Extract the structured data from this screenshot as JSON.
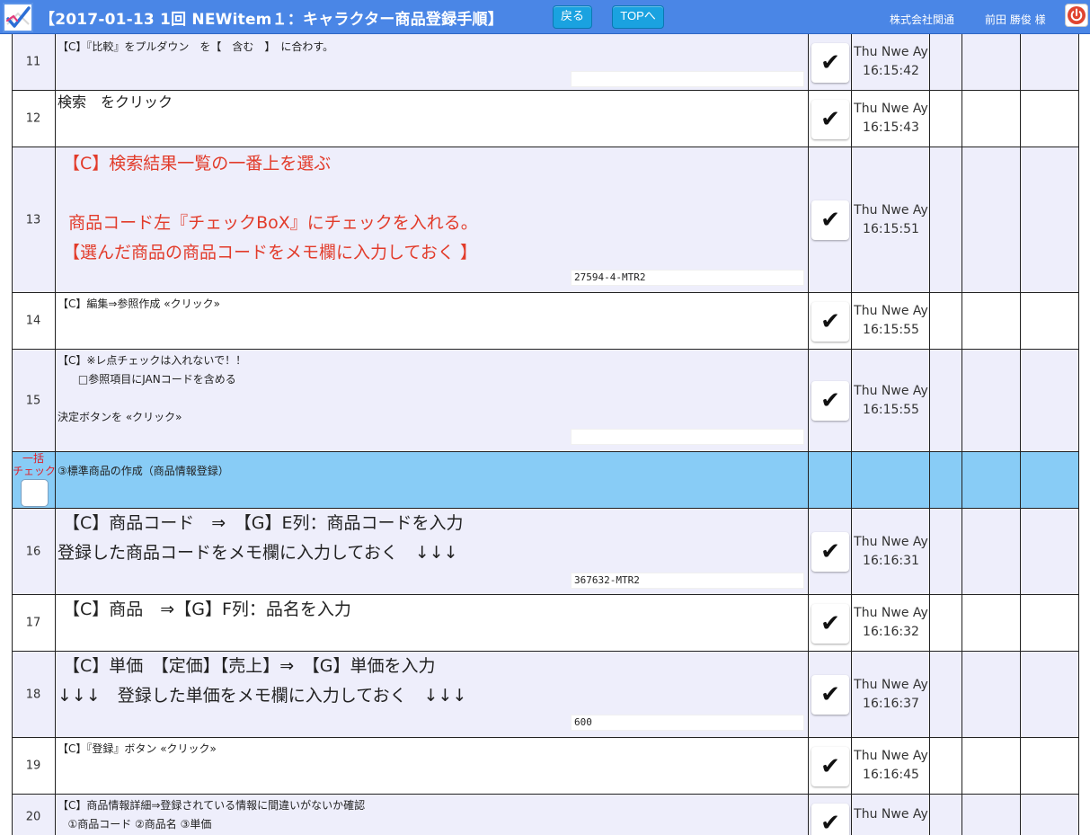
{
  "header": {
    "title": "【2017-01-13 1回 NEWitem１：キャラクター商品登録手順】",
    "back_label": "戻る",
    "top_label": "TOPへ",
    "company": "株式会社関通",
    "user": "前田 勝俊 様",
    "accent_color": "#4a86e6",
    "logo_icon": "checkmark-logo-icon",
    "power_icon": "power-icon"
  },
  "bulk_check": {
    "label_line1": "一括",
    "label_line2": "チェック"
  },
  "check_mark": "✔",
  "rows": [
    {
      "num": "11",
      "lines": [
        "【C】『比較』をプルダウン　を【　含む　】　に合わす。"
      ],
      "memo": "",
      "checked": true,
      "time_line1": "Thu Nwe Ay",
      "time_line2": "16:15:42"
    },
    {
      "num": "12",
      "lines": [
        "検索　をクリック"
      ],
      "memo": "",
      "checked": true,
      "time_line1": "Thu Nwe Ay",
      "time_line2": "16:15:43"
    },
    {
      "num": "13",
      "lines": [
        " 【C】検索結果一覧の一番上を選ぶ",
        "",
        "  商品コード左『チェックBoX』にチェックを入れる。",
        " 【選んだ商品の商品コードをメモ欄に入力しておく 】"
      ],
      "memo": "27594-4-MTR2",
      "checked": true,
      "time_line1": "Thu Nwe Ay",
      "time_line2": "16:15:51"
    },
    {
      "num": "14",
      "lines": [
        "【C】編集⇒参照作成 «クリック»"
      ],
      "memo": "",
      "checked": true,
      "time_line1": "Thu Nwe Ay",
      "time_line2": "16:15:55"
    },
    {
      "num": "15",
      "lines": [
        "【C】※レ点チェックは入れないで！！",
        "      □参照項目にJANコードを含める",
        "",
        "決定ボタンを «クリック»"
      ],
      "memo": "",
      "checked": true,
      "time_line1": "Thu Nwe Ay",
      "time_line2": "16:15:55"
    },
    {
      "num": "",
      "section": true,
      "lines": [
        "③標準商品の作成（商品情報登録）"
      ]
    },
    {
      "num": "16",
      "lines": [
        " 【C】商品コード　⇒　【G】E列：商品コードを入力",
        "登録した商品コードをメモ欄に入力しておく　↓↓↓"
      ],
      "memo": "367632-MTR2",
      "checked": true,
      "time_line1": "Thu Nwe Ay",
      "time_line2": "16:16:31"
    },
    {
      "num": "17",
      "lines": [
        " 【C】商品　⇒【G】F列：品名を入力"
      ],
      "memo": "",
      "checked": true,
      "time_line1": "Thu Nwe Ay",
      "time_line2": "16:16:32"
    },
    {
      "num": "18",
      "lines": [
        " 【C】単価　【定価】【売上】⇒　【G】単価を入力",
        "↓↓↓　登録した単価をメモ欄に入力しておく　↓↓↓"
      ],
      "memo": "600",
      "checked": true,
      "time_line1": "Thu Nwe Ay",
      "time_line2": "16:16:37"
    },
    {
      "num": "19",
      "lines": [
        "【C】『登録』ボタン «クリック»"
      ],
      "memo": "",
      "checked": true,
      "time_line1": "Thu Nwe Ay",
      "time_line2": "16:16:45"
    },
    {
      "num": "20",
      "lines": [
        "【C】商品情報詳細⇒登録されている情報に間違いがないか確認",
        "   ①商品コード ②商品名 ③単価"
      ],
      "memo": "",
      "checked": true,
      "time_line1": "Thu Nwe Ay",
      "time_line2": ""
    }
  ]
}
